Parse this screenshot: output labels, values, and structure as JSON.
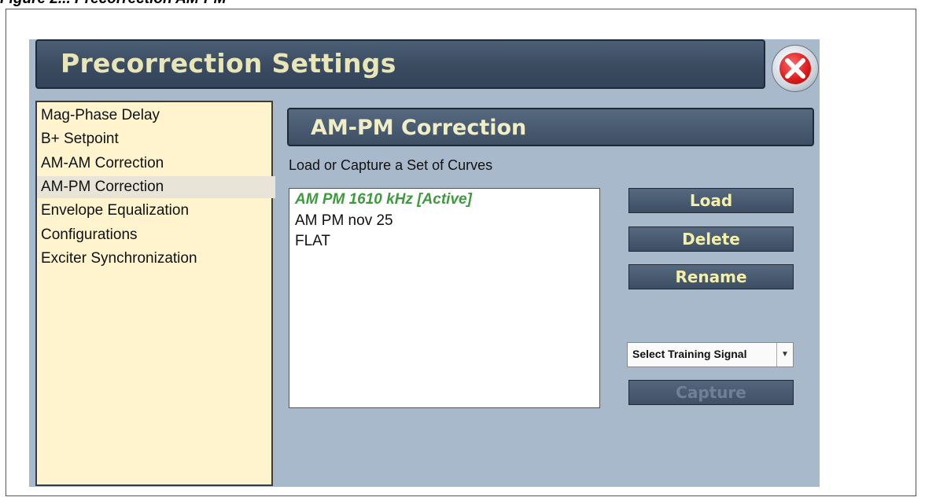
{
  "caption": "Figure 2... Precorrection AM-PM",
  "title": "Precorrection Settings",
  "menu": {
    "items": [
      {
        "label": "Mag-Phase Delay"
      },
      {
        "label": "B+ Setpoint"
      },
      {
        "label": "AM-AM Correction"
      },
      {
        "label": "AM-PM Correction",
        "selected": true
      },
      {
        "label": "Envelope Equalization"
      },
      {
        "label": "Configurations"
      },
      {
        "label": "Exciter Synchronization"
      }
    ]
  },
  "section": {
    "header": "AM-PM Correction",
    "subtitle": "Load or Capture a Set of Curves"
  },
  "curves": [
    {
      "label": "AM PM 1610 kHz [Active]",
      "active": true
    },
    {
      "label": "AM PM nov 25",
      "active": false
    },
    {
      "label": "FLAT",
      "active": false
    }
  ],
  "buttons": {
    "load": "Load",
    "delete": "Delete",
    "rename": "Rename",
    "capture": "Capture"
  },
  "training_select": {
    "value": "Select Training Signal"
  },
  "icons": {
    "close": "close-icon",
    "dropdown": "chevron-down-icon"
  },
  "colors": {
    "active_curve": "#3f9a3f",
    "button_text": "#f4f0a8",
    "title_text": "#e8e6b6",
    "menu_bg": "#fff4ce",
    "screen_bg": "#a9b9cc"
  }
}
